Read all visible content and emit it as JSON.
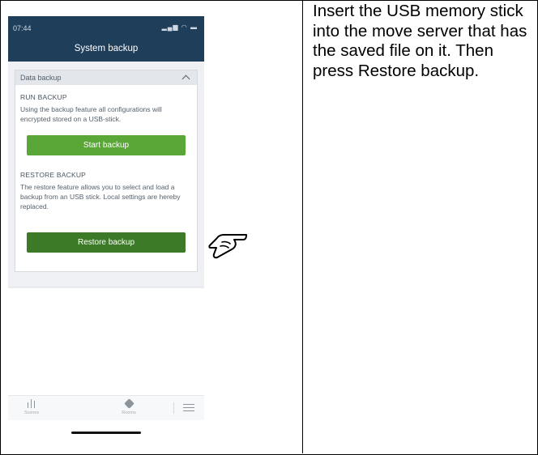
{
  "status_bar": {
    "time": "07:44",
    "icons": "▂▄▆ ◠ ▬"
  },
  "header": {
    "title": "System backup"
  },
  "card": {
    "header_label": "Data backup",
    "run": {
      "title": "RUN BACKUP",
      "description": "Using the backup feature all configurations will encrypted stored on a USB-stick.",
      "button_label": "Start backup"
    },
    "restore": {
      "title": "RESTORE BACKUP",
      "description": "The restore feature allows you to select and load a backup from an USB stick. Local settings are hereby replaced.",
      "button_label": "Restore backup"
    }
  },
  "tabbar": {
    "scenes_label": "Scenes",
    "rooms_label": "Rooms"
  },
  "instruction": {
    "text": "Insert the USB memory stick into the move server that has the saved file on it. Then press Restore backup."
  },
  "colors": {
    "header_bg": "#1f3e5a",
    "start_button": "#5aa636",
    "restore_button": "#3d7a27"
  },
  "icons": [
    "signal-icon",
    "wifi-icon",
    "battery-icon",
    "chevron-up-icon",
    "scenes-icon",
    "rooms-icon",
    "menu-icon",
    "pointing-hand-icon"
  ]
}
